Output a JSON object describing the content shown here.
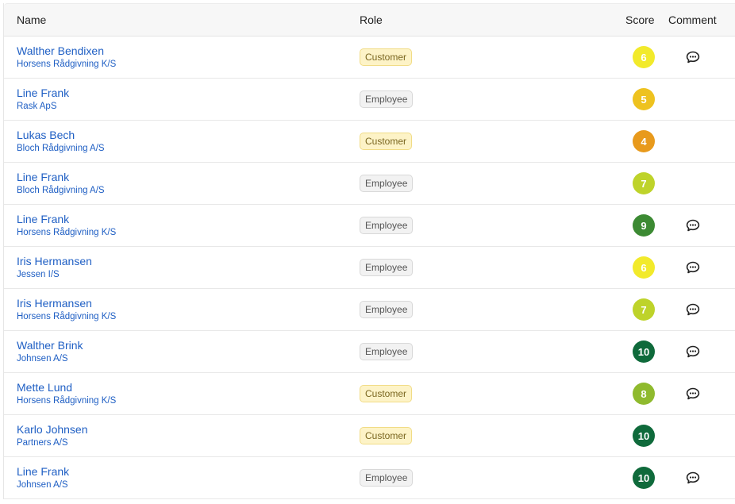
{
  "header": {
    "name": "Name",
    "role": "Role",
    "score": "Score",
    "comment": "Comment"
  },
  "role_styles": {
    "Customer": "customer",
    "Employee": "employee"
  },
  "score_colors": {
    "4": "#e89a1c",
    "5": "#eec21f",
    "6": "#f2ea2b",
    "7": "#bed32a",
    "8": "#8fba2e",
    "9": "#3c8a33",
    "10": "#0f6a3b"
  },
  "rows": [
    {
      "name": "Walther Bendixen",
      "company": "Horsens Rådgivning K/S",
      "role": "Customer",
      "score": "6",
      "comment": true
    },
    {
      "name": "Line Frank",
      "company": "Rask ApS",
      "role": "Employee",
      "score": "5",
      "comment": false
    },
    {
      "name": "Lukas Bech",
      "company": "Bloch Rådgivning A/S",
      "role": "Customer",
      "score": "4",
      "comment": false
    },
    {
      "name": "Line Frank",
      "company": "Bloch Rådgivning A/S",
      "role": "Employee",
      "score": "7",
      "comment": false
    },
    {
      "name": "Line Frank",
      "company": "Horsens Rådgivning K/S",
      "role": "Employee",
      "score": "9",
      "comment": true
    },
    {
      "name": "Iris Hermansen",
      "company": "Jessen I/S",
      "role": "Employee",
      "score": "6",
      "comment": true
    },
    {
      "name": "Iris Hermansen",
      "company": "Horsens Rådgivning K/S",
      "role": "Employee",
      "score": "7",
      "comment": true
    },
    {
      "name": "Walther Brink",
      "company": "Johnsen A/S",
      "role": "Employee",
      "score": "10",
      "comment": true
    },
    {
      "name": "Mette Lund",
      "company": "Horsens Rådgivning K/S",
      "role": "Customer",
      "score": "8",
      "comment": true
    },
    {
      "name": "Karlo Johnsen",
      "company": "Partners A/S",
      "role": "Customer",
      "score": "10",
      "comment": false
    },
    {
      "name": "Line Frank",
      "company": "Johnsen A/S",
      "role": "Employee",
      "score": "10",
      "comment": true
    }
  ]
}
